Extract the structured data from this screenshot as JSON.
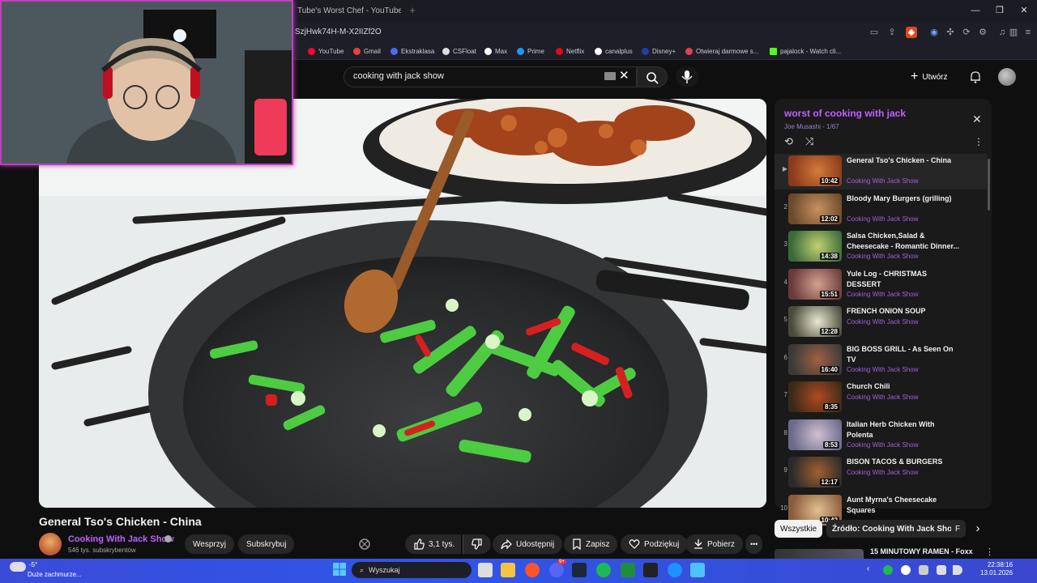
{
  "browser": {
    "tab_title": "Tube's Worst Chef - YouTube",
    "new_tab": "+",
    "url": "SzjHwk74H-M-X2IIZf2O",
    "window_buttons": [
      "—",
      "❐",
      "✕"
    ],
    "bookmarks": [
      {
        "label": "YouTube",
        "color": "#ff0033"
      },
      {
        "label": "Gmail",
        "color": "#ea4335"
      },
      {
        "label": "Ekstraklasa",
        "color": "#4a6cf7"
      },
      {
        "label": "CSFloat",
        "color": "#dddddd"
      },
      {
        "label": "Max",
        "color": "#ffffff"
      },
      {
        "label": "Prime",
        "color": "#1a98ff"
      },
      {
        "label": "Netflix",
        "color": "#e50914"
      },
      {
        "label": "canalplus",
        "color": "#ffffff"
      },
      {
        "label": "Disney+",
        "color": "#1f3fa8"
      },
      {
        "label": "Otwieraj darmowe s...",
        "color": "#e0405a"
      },
      {
        "label": "pajalock - Watch cli...",
        "color": "#53fc18"
      }
    ]
  },
  "youtube": {
    "search_value": "cooking with jack show",
    "create_label": "Utwórz",
    "video_title": "General Tso's Chicken - China",
    "channel_name": "Cooking With Jack Show",
    "subscribers": "546 tys. subskrybentów",
    "support_label": "Wesprzyj",
    "subscribe_label": "Subskrybuj",
    "likes": "3,1 tys.",
    "share_label": "Udostępnij",
    "save_label": "Zapisz",
    "thanks_label": "Podziękuj",
    "download_label": "Pobierz",
    "more_label": "•••"
  },
  "playlist": {
    "title": "worst of cooking with jack",
    "subtitle": "Joe Musashi - 1/67",
    "items": [
      {
        "index": "▶",
        "title": "General Tso's Chicken - China",
        "channel": "Cooking With Jack Show",
        "duration": "10:42"
      },
      {
        "index": "2",
        "title": "Bloody Mary Burgers (grilling)",
        "channel": "Cooking With Jack Show",
        "duration": "12:02"
      },
      {
        "index": "3",
        "title": "Salsa Chicken,Salad & Cheesecake - Romantic Dinner...",
        "channel": "Cooking With Jack Show",
        "duration": "14:38"
      },
      {
        "index": "4",
        "title": "Yule Log - CHRISTMAS DESSERT",
        "channel": "Cooking With Jack Show",
        "duration": "15:51"
      },
      {
        "index": "5",
        "title": "FRENCH ONION SOUP",
        "channel": "Cooking With Jack Show",
        "duration": "12:28"
      },
      {
        "index": "6",
        "title": "BIG BOSS GRILL - As Seen On TV",
        "channel": "Cooking With Jack Show",
        "duration": "16:40"
      },
      {
        "index": "7",
        "title": "Church Chili",
        "channel": "Cooking With Jack Show",
        "duration": "8:35"
      },
      {
        "index": "8",
        "title": "Italian Herb Chicken With Polenta",
        "channel": "Cooking With Jack Show",
        "duration": "8:53"
      },
      {
        "index": "9",
        "title": "BISON TACOS & BURGERS",
        "channel": "Cooking With Jack Show",
        "duration": "12:17"
      },
      {
        "index": "10",
        "title": "Aunt Myrna's Cheesecake Squares",
        "channel": "",
        "duration": "10:42"
      }
    ]
  },
  "chips": {
    "all": "Wszystkie",
    "source": "Źródło: Cooking With Jack Show",
    "peek": "F"
  },
  "recommendation_peek": {
    "title": "15 MINUTOWY RAMEN - Foxx"
  },
  "taskbar": {
    "weather_temp": "-5°",
    "weather_desc": "Duże zachmurze...",
    "search_label": "Wyszukaj",
    "time": "22:38:16",
    "date": "13.01.2026",
    "discord_badge": "9+"
  }
}
